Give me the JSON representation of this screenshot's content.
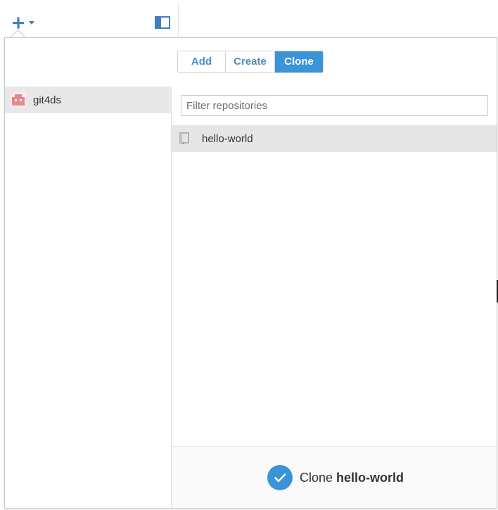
{
  "toolbar": {
    "add_icon": "plus-icon",
    "dropdown_icon": "caret-down-icon",
    "sidebar_toggle_icon": "sidebar-toggle-icon"
  },
  "tabs": [
    {
      "label": "Add",
      "active": false
    },
    {
      "label": "Create",
      "active": false
    },
    {
      "label": "Clone",
      "active": true
    }
  ],
  "accounts": [
    {
      "name": "git4ds",
      "avatar_icon": "identicon-avatar",
      "avatar_color": "#e08a8a",
      "selected": true
    }
  ],
  "filter": {
    "placeholder": "Filter repositories",
    "value": ""
  },
  "repositories": [
    {
      "name": "hello-world",
      "icon": "repo-book-icon",
      "selected": true
    }
  ],
  "clone": {
    "prefix": "Clone",
    "repo_name": "hello-world",
    "icon": "check-circle-icon",
    "accent_color": "#3b93d8"
  },
  "colors": {
    "accent": "#3b93d8",
    "link_blue": "#4a8ec2",
    "selected_row": "#e6e6e6"
  }
}
